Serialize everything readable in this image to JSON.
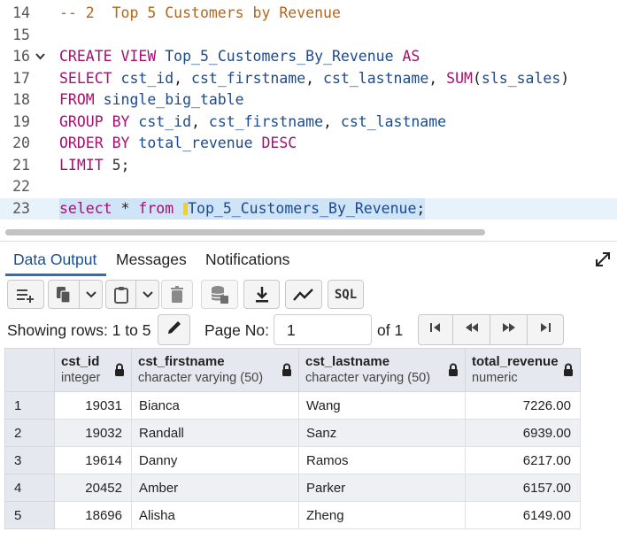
{
  "editor": {
    "lines": [
      {
        "no": "14",
        "fold": "",
        "tokens": [
          {
            "t": "-- 2  Top 5 Customers by Revenue",
            "c": "cm"
          }
        ]
      },
      {
        "no": "15",
        "fold": "",
        "tokens": []
      },
      {
        "no": "16",
        "fold": "v",
        "tokens": [
          {
            "t": "CREATE VIEW ",
            "c": "kw"
          },
          {
            "t": "Top_5_Customers_By_Revenue ",
            "c": "id"
          },
          {
            "t": "AS",
            "c": "kw"
          }
        ]
      },
      {
        "no": "17",
        "fold": "",
        "tokens": [
          {
            "t": "SELECT ",
            "c": "kw"
          },
          {
            "t": "cst_id",
            "c": "id"
          },
          {
            "t": ", ",
            "c": "pn"
          },
          {
            "t": "cst_firstname",
            "c": "id"
          },
          {
            "t": ", ",
            "c": "pn"
          },
          {
            "t": "cst_lastname",
            "c": "id"
          },
          {
            "t": ", ",
            "c": "pn"
          },
          {
            "t": "SUM",
            "c": "kw"
          },
          {
            "t": "(",
            "c": "pn"
          },
          {
            "t": "sls_sales",
            "c": "id"
          },
          {
            "t": ")",
            "c": "pn"
          }
        ]
      },
      {
        "no": "18",
        "fold": "",
        "tokens": [
          {
            "t": "FROM ",
            "c": "kw"
          },
          {
            "t": "single_big_table",
            "c": "id"
          }
        ]
      },
      {
        "no": "19",
        "fold": "",
        "tokens": [
          {
            "t": "GROUP BY ",
            "c": "kw"
          },
          {
            "t": "cst_id",
            "c": "id"
          },
          {
            "t": ", ",
            "c": "pn"
          },
          {
            "t": "cst_firstname",
            "c": "id"
          },
          {
            "t": ", ",
            "c": "pn"
          },
          {
            "t": "cst_lastname",
            "c": "id"
          }
        ]
      },
      {
        "no": "20",
        "fold": "",
        "tokens": [
          {
            "t": "ORDER BY ",
            "c": "kw"
          },
          {
            "t": "total_revenue ",
            "c": "id"
          },
          {
            "t": "DESC",
            "c": "kw"
          }
        ]
      },
      {
        "no": "21",
        "fold": "",
        "tokens": [
          {
            "t": "LIMIT ",
            "c": "kw"
          },
          {
            "t": "5",
            "c": "num"
          },
          {
            "t": ";",
            "c": "pn"
          }
        ]
      },
      {
        "no": "22",
        "fold": "",
        "tokens": []
      },
      {
        "no": "23",
        "fold": "",
        "highlight": true,
        "tokens": [
          {
            "t": "select ",
            "c": "kw"
          },
          {
            "t": "* ",
            "c": "pn"
          },
          {
            "t": "from ",
            "c": "kw"
          },
          {
            "t": "|cursor|",
            "c": "cursor"
          },
          {
            "t": "Top_5_Customers_By_Revenue",
            "c": "id"
          },
          {
            "t": ";",
            "c": "pn"
          }
        ]
      }
    ]
  },
  "tabs": {
    "data_output": "Data Output",
    "messages": "Messages",
    "notifications": "Notifications"
  },
  "toolbar": {
    "sql_label": "SQL"
  },
  "pager": {
    "showing_rows": "Showing rows: 1 to 5",
    "page_no_label": "Page No:",
    "page_value": "1",
    "of_label": "of 1"
  },
  "grid": {
    "columns": [
      {
        "name": "cst_id",
        "type": "integer"
      },
      {
        "name": "cst_firstname",
        "type": "character varying (50)"
      },
      {
        "name": "cst_lastname",
        "type": "character varying (50)"
      },
      {
        "name": "total_revenue",
        "type": "numeric"
      }
    ],
    "rows": [
      {
        "n": "1",
        "cells": [
          "19031",
          "Bianca",
          "Wang",
          "7226.00"
        ]
      },
      {
        "n": "2",
        "cells": [
          "19032",
          "Randall",
          "Sanz",
          "6939.00"
        ]
      },
      {
        "n": "3",
        "cells": [
          "19614",
          "Danny",
          "Ramos",
          "6217.00"
        ]
      },
      {
        "n": "4",
        "cells": [
          "20452",
          "Amber",
          "Parker",
          "6157.00"
        ]
      },
      {
        "n": "5",
        "cells": [
          "18696",
          "Alisha",
          "Zheng",
          "6149.00"
        ]
      }
    ]
  },
  "colors": {
    "keyword": "#a5106e",
    "identifier": "#1c4a8c",
    "comment": "#b4661a",
    "active_tab": "#326dbb",
    "header_bg": "#e5e9ef"
  }
}
